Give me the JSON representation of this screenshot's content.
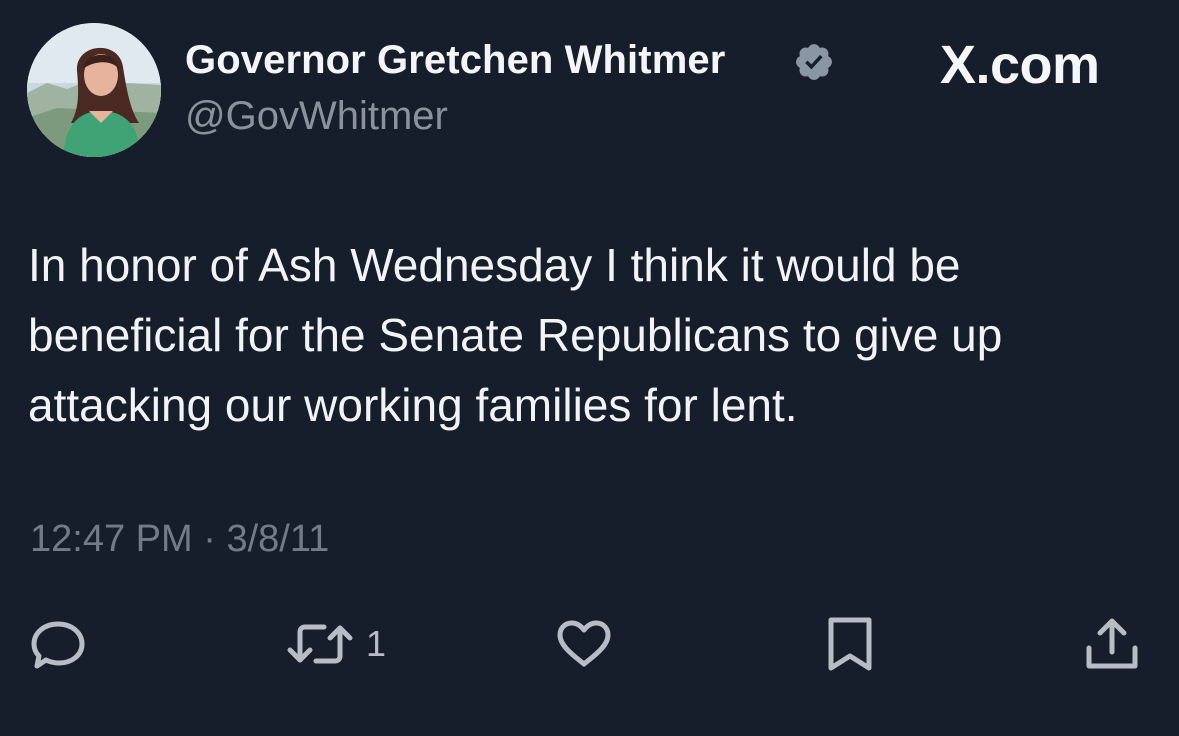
{
  "author": {
    "display_name": "Governor Gretchen Whitmer",
    "handle": "@GovWhitmer",
    "verified_icon": "verified-badge-icon",
    "avatar_icon": "avatar"
  },
  "brand": {
    "label": "X.com"
  },
  "tweet": {
    "text": "In honor of Ash Wednesday I think it would be beneficial for the Senate Republicans to give up attacking our working families for lent.",
    "time": "12:47 PM",
    "separator": "·",
    "date": "3/8/11"
  },
  "actions": [
    {
      "icon": "reply-icon",
      "count": ""
    },
    {
      "icon": "retweet-icon",
      "count": "1"
    },
    {
      "icon": "like-icon",
      "count": ""
    },
    {
      "icon": "bookmark-icon",
      "count": ""
    },
    {
      "icon": "share-icon",
      "count": ""
    }
  ],
  "colors": {
    "background": "#171e2b",
    "primary_text": "#f1f3f5",
    "secondary_text": "#8a929b",
    "icon": "#b6bdc4",
    "verified_badge": "#8a96a3"
  }
}
